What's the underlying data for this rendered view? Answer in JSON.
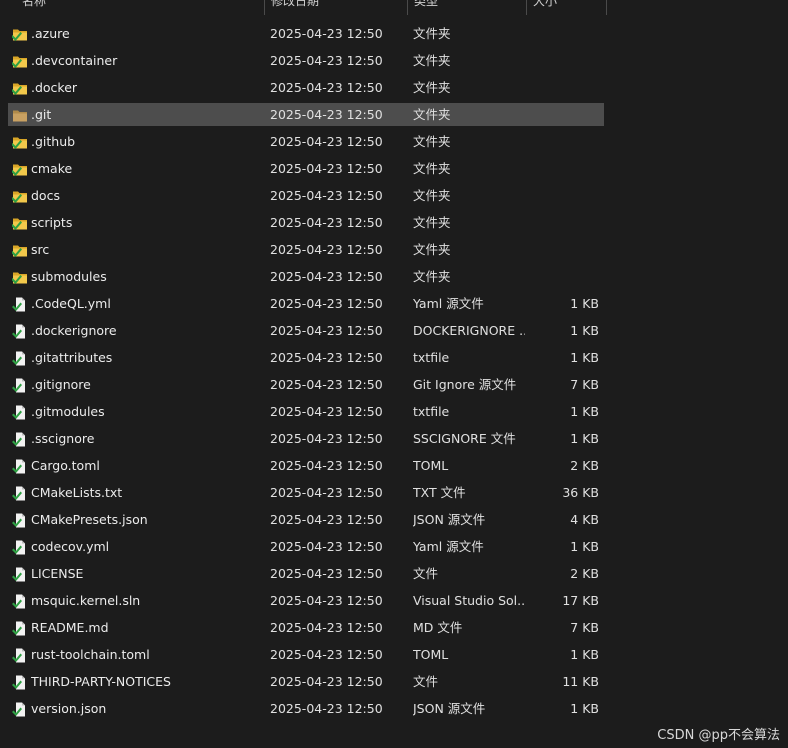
{
  "columns": {
    "name": "名称",
    "date": "修改日期",
    "type": "类型",
    "size": "大小"
  },
  "files": [
    {
      "name": ".azure",
      "date": "2025-04-23 12:50",
      "type": "文件夹",
      "size": "",
      "icon": "folder-green-icon"
    },
    {
      "name": ".devcontainer",
      "date": "2025-04-23 12:50",
      "type": "文件夹",
      "size": "",
      "icon": "folder-green-icon"
    },
    {
      "name": ".docker",
      "date": "2025-04-23 12:50",
      "type": "文件夹",
      "size": "",
      "icon": "folder-green-icon"
    },
    {
      "name": ".git",
      "date": "2025-04-23 12:50",
      "type": "文件夹",
      "size": "",
      "icon": "folder-plain-icon"
    },
    {
      "name": ".github",
      "date": "2025-04-23 12:50",
      "type": "文件夹",
      "size": "",
      "icon": "folder-green-icon"
    },
    {
      "name": "cmake",
      "date": "2025-04-23 12:50",
      "type": "文件夹",
      "size": "",
      "icon": "folder-green-icon"
    },
    {
      "name": "docs",
      "date": "2025-04-23 12:50",
      "type": "文件夹",
      "size": "",
      "icon": "folder-green-icon"
    },
    {
      "name": "scripts",
      "date": "2025-04-23 12:50",
      "type": "文件夹",
      "size": "",
      "icon": "folder-green-icon"
    },
    {
      "name": "src",
      "date": "2025-04-23 12:50",
      "type": "文件夹",
      "size": "",
      "icon": "folder-green-icon"
    },
    {
      "name": "submodules",
      "date": "2025-04-23 12:50",
      "type": "文件夹",
      "size": "",
      "icon": "folder-green-icon"
    },
    {
      "name": ".CodeQL.yml",
      "date": "2025-04-23 12:50",
      "type": "Yaml 源文件",
      "size": "1 KB",
      "icon": "file-green-icon"
    },
    {
      "name": ".dockerignore",
      "date": "2025-04-23 12:50",
      "type": "DOCKERIGNORE ...",
      "size": "1 KB",
      "icon": "file-green-icon"
    },
    {
      "name": ".gitattributes",
      "date": "2025-04-23 12:50",
      "type": "txtfile",
      "size": "1 KB",
      "icon": "file-green-icon"
    },
    {
      "name": ".gitignore",
      "date": "2025-04-23 12:50",
      "type": "Git Ignore 源文件",
      "size": "7 KB",
      "icon": "file-green-icon"
    },
    {
      "name": ".gitmodules",
      "date": "2025-04-23 12:50",
      "type": "txtfile",
      "size": "1 KB",
      "icon": "file-green-icon"
    },
    {
      "name": ".sscignore",
      "date": "2025-04-23 12:50",
      "type": "SSCIGNORE 文件",
      "size": "1 KB",
      "icon": "file-green-icon"
    },
    {
      "name": "Cargo.toml",
      "date": "2025-04-23 12:50",
      "type": "TOML",
      "size": "2 KB",
      "icon": "file-green-icon"
    },
    {
      "name": "CMakeLists.txt",
      "date": "2025-04-23 12:50",
      "type": "TXT 文件",
      "size": "36 KB",
      "icon": "file-green-icon"
    },
    {
      "name": "CMakePresets.json",
      "date": "2025-04-23 12:50",
      "type": "JSON 源文件",
      "size": "4 KB",
      "icon": "file-green-icon"
    },
    {
      "name": "codecov.yml",
      "date": "2025-04-23 12:50",
      "type": "Yaml 源文件",
      "size": "1 KB",
      "icon": "file-green-icon"
    },
    {
      "name": "LICENSE",
      "date": "2025-04-23 12:50",
      "type": "文件",
      "size": "2 KB",
      "icon": "file-green-icon"
    },
    {
      "name": "msquic.kernel.sln",
      "date": "2025-04-23 12:50",
      "type": "Visual Studio Sol...",
      "size": "17 KB",
      "icon": "file-green-icon"
    },
    {
      "name": "README.md",
      "date": "2025-04-23 12:50",
      "type": "MD 文件",
      "size": "7 KB",
      "icon": "file-green-icon"
    },
    {
      "name": "rust-toolchain.toml",
      "date": "2025-04-23 12:50",
      "type": "TOML",
      "size": "1 KB",
      "icon": "file-green-icon"
    },
    {
      "name": "THIRD-PARTY-NOTICES",
      "date": "2025-04-23 12:50",
      "type": "文件",
      "size": "11 KB",
      "icon": "file-green-icon"
    },
    {
      "name": "version.json",
      "date": "2025-04-23 12:50",
      "type": "JSON 源文件",
      "size": "1 KB",
      "icon": "file-green-icon"
    }
  ],
  "selected_index": 3,
  "watermark": "CSDN @pp不会算法",
  "colors": {
    "background": "#1c1c1c",
    "selection": "#4d4d4d",
    "folder": "#e8b93a",
    "git_green": "#3fb950"
  }
}
